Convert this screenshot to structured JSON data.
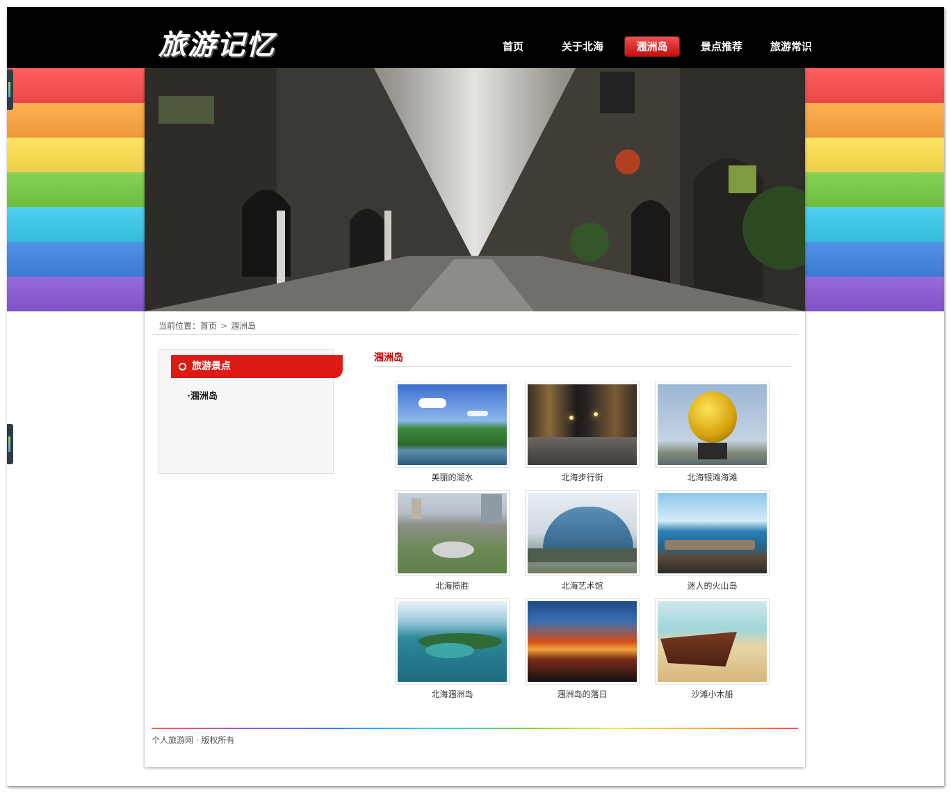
{
  "site": {
    "logo_text": "旅游记忆"
  },
  "nav": [
    {
      "label": "首页",
      "active": false
    },
    {
      "label": "关于北海",
      "active": false
    },
    {
      "label": "涠洲岛",
      "active": true
    },
    {
      "label": "景点推荐",
      "active": false
    },
    {
      "label": "旅游常识",
      "active": false
    }
  ],
  "stripe_colors": [
    "#ff4d4d",
    "#ffa63f",
    "#ffe150",
    "#78cd42",
    "#3acbf0",
    "#3f86e3",
    "#8a5ad8"
  ],
  "breadcrumb": {
    "prefix": "当前位置：",
    "home": "首页",
    "current": "涠洲岛"
  },
  "sidebar": {
    "title": "旅游景点",
    "items": [
      "·涠洲岛"
    ]
  },
  "main": {
    "title": "涠洲岛"
  },
  "gallery": [
    {
      "caption": "美丽的湖水",
      "icon": "lake-photo"
    },
    {
      "caption": "北海步行街",
      "icon": "street-night-photo"
    },
    {
      "caption": "北海银滩海滩",
      "icon": "golden-sculpture-photo"
    },
    {
      "caption": "北海揽胜",
      "icon": "city-aerial-photo"
    },
    {
      "caption": "北海艺术馆",
      "icon": "art-museum-photo"
    },
    {
      "caption": "迷人的火山岛",
      "icon": "volcanic-coast-photo"
    },
    {
      "caption": "北海涠洲岛",
      "icon": "island-aerial-photo"
    },
    {
      "caption": "涠洲岛的落日",
      "icon": "sunset-photo"
    },
    {
      "caption": "沙滩小木船",
      "icon": "wooden-boat-photo"
    }
  ],
  "footer": {
    "text": "个人旅游网 · 版权所有"
  },
  "colors": {
    "accent_red": "#dd1a14",
    "title_red": "#cc0000",
    "header_bg": "#000000"
  }
}
